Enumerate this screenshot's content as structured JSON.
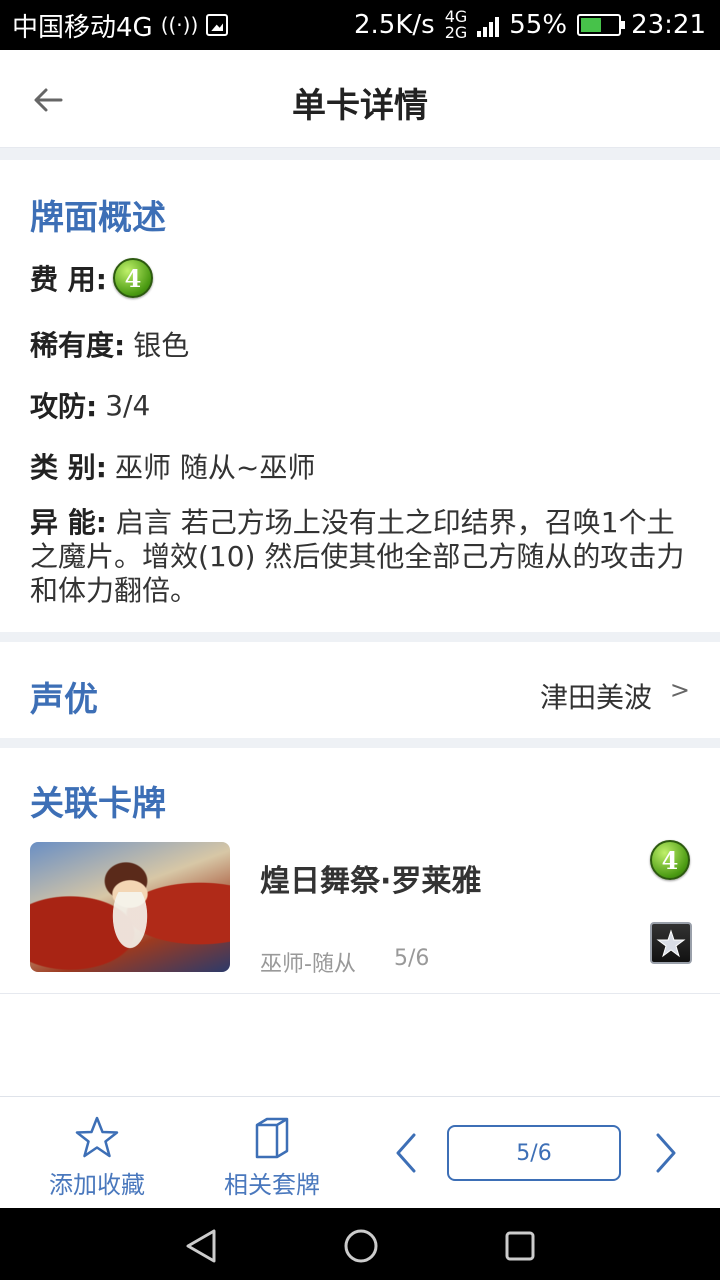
{
  "status_bar": {
    "carrier": "中国移动4G",
    "speed": "2.5K/s",
    "battery_pct": "55%",
    "time": "23:21",
    "battery_level": 0.55
  },
  "header": {
    "title": "单卡详情"
  },
  "overview": {
    "title": "牌面概述",
    "cost_label": "费 用:",
    "cost_value": "4",
    "rarity_label": "稀有度:",
    "rarity_value": "银色",
    "atk_label": "攻防:",
    "atk_value": "3/4",
    "class_label": "类 别:",
    "class_value": "巫师 随从~巫师",
    "ability_label": "异 能:",
    "ability_value": "启言 若己方场上没有土之印结界，召唤1个土之魔片。增效(10) 然后使其他全部己方随从的攻击力和体力翻倍。"
  },
  "voice": {
    "title": "声优",
    "actor": "津田美波",
    "arrow": ">"
  },
  "related": {
    "title": "关联卡牌",
    "items": [
      {
        "name": "煌日舞祭·罗莱雅",
        "type": "巫师-随从",
        "stats": "5/6",
        "cost": "4"
      }
    ]
  },
  "bottom_bar": {
    "favorite_label": "添加收藏",
    "decks_label": "相关套牌",
    "page": "5/6"
  },
  "colors": {
    "accent": "#3d6fb6",
    "section_gap": "#eef1f5"
  }
}
